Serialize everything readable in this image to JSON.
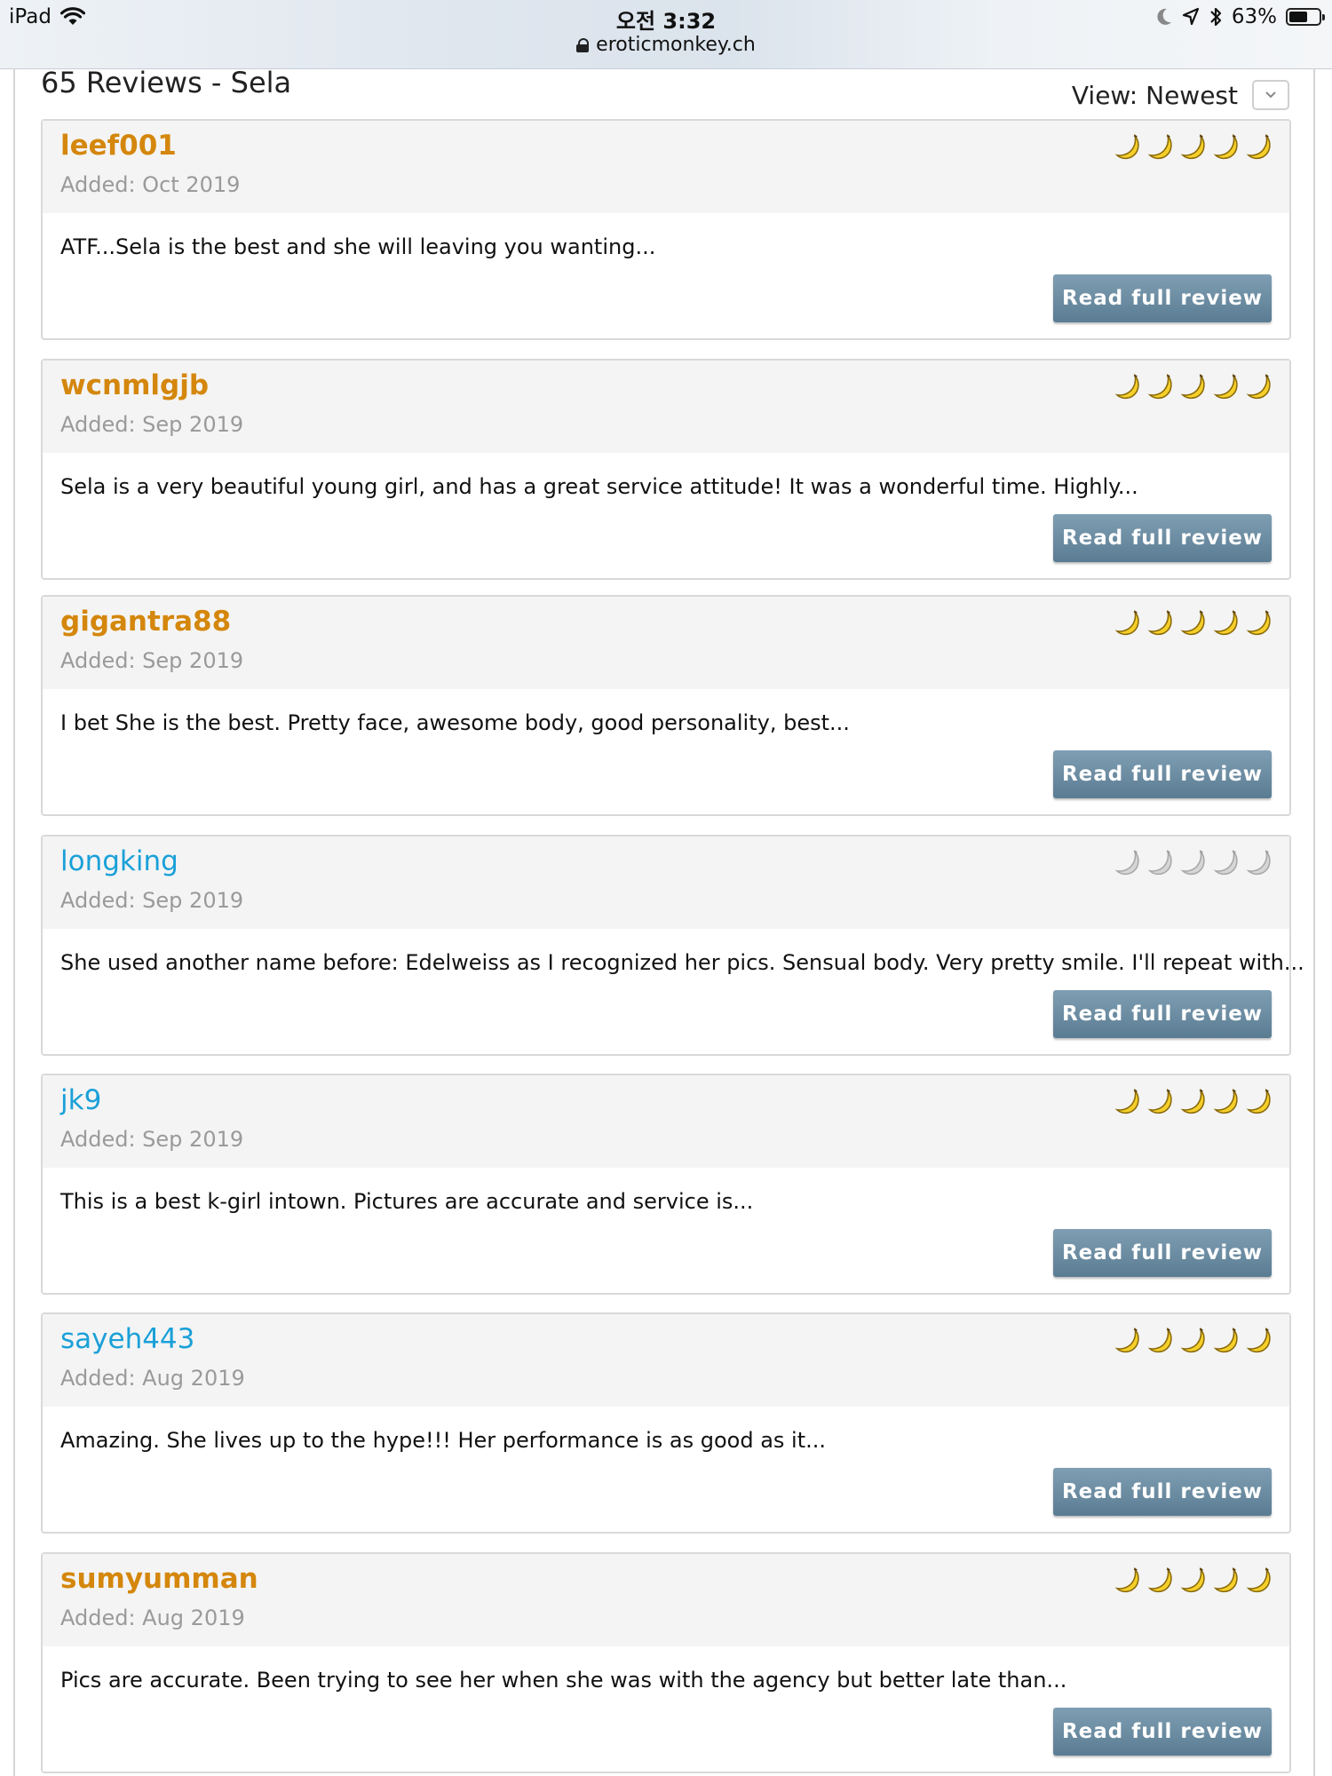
{
  "status_bar": {
    "device": "iPad",
    "time": "오전 3:32",
    "url": "eroticmonkey.ch",
    "battery": "63%",
    "battery_level": 0.63
  },
  "page": {
    "heading": "65 Reviews - Sela",
    "view_label": "View: Newest"
  },
  "colors": {
    "username_gold": "#d4870c",
    "username_blue": "#1aa0d8",
    "button": "#6a8ca2"
  },
  "reviews": [
    {
      "user": "leef001",
      "added": "Added: Oct 2019",
      "snippet": "ATF...Sela is the best and she will leaving you wanting...",
      "button": "Read full review",
      "rating": 5
    },
    {
      "user": "wcnmlgjb",
      "added": "Added: Sep 2019",
      "snippet": "Sela is a very beautiful young girl, and has a great service attitude! It was a wonderful time. Highly...",
      "button": "Read full review",
      "rating": 5
    },
    {
      "user": "gigantra88",
      "added": "Added: Sep 2019",
      "snippet": "I bet She is the best. Pretty face, awesome body, good personality, best...",
      "button": "Read full review",
      "rating": 5
    },
    {
      "user": "longking",
      "added": "Added: Sep 2019",
      "snippet": "She used another name before: Edelweiss as I recognized her pics. Sensual body. Very pretty smile. I'll repeat with...",
      "button": "Read full review",
      "rating": 0
    },
    {
      "user": "jk9",
      "added": "Added: Sep 2019",
      "snippet": "This is a best k-girl intown. Pictures are accurate and service is...",
      "button": "Read full review",
      "rating": 5
    },
    {
      "user": "sayeh443",
      "added": "Added: Aug 2019",
      "snippet": "Amazing. She lives up to the hype!!! Her performance is as good as it...",
      "button": "Read full review",
      "rating": 5
    },
    {
      "user": "sumyumman",
      "added": "Added: Aug 2019",
      "snippet": "Pics are accurate. Been trying to see her when she was with the agency but better late than...",
      "button": "Read full review",
      "rating": 5
    }
  ]
}
